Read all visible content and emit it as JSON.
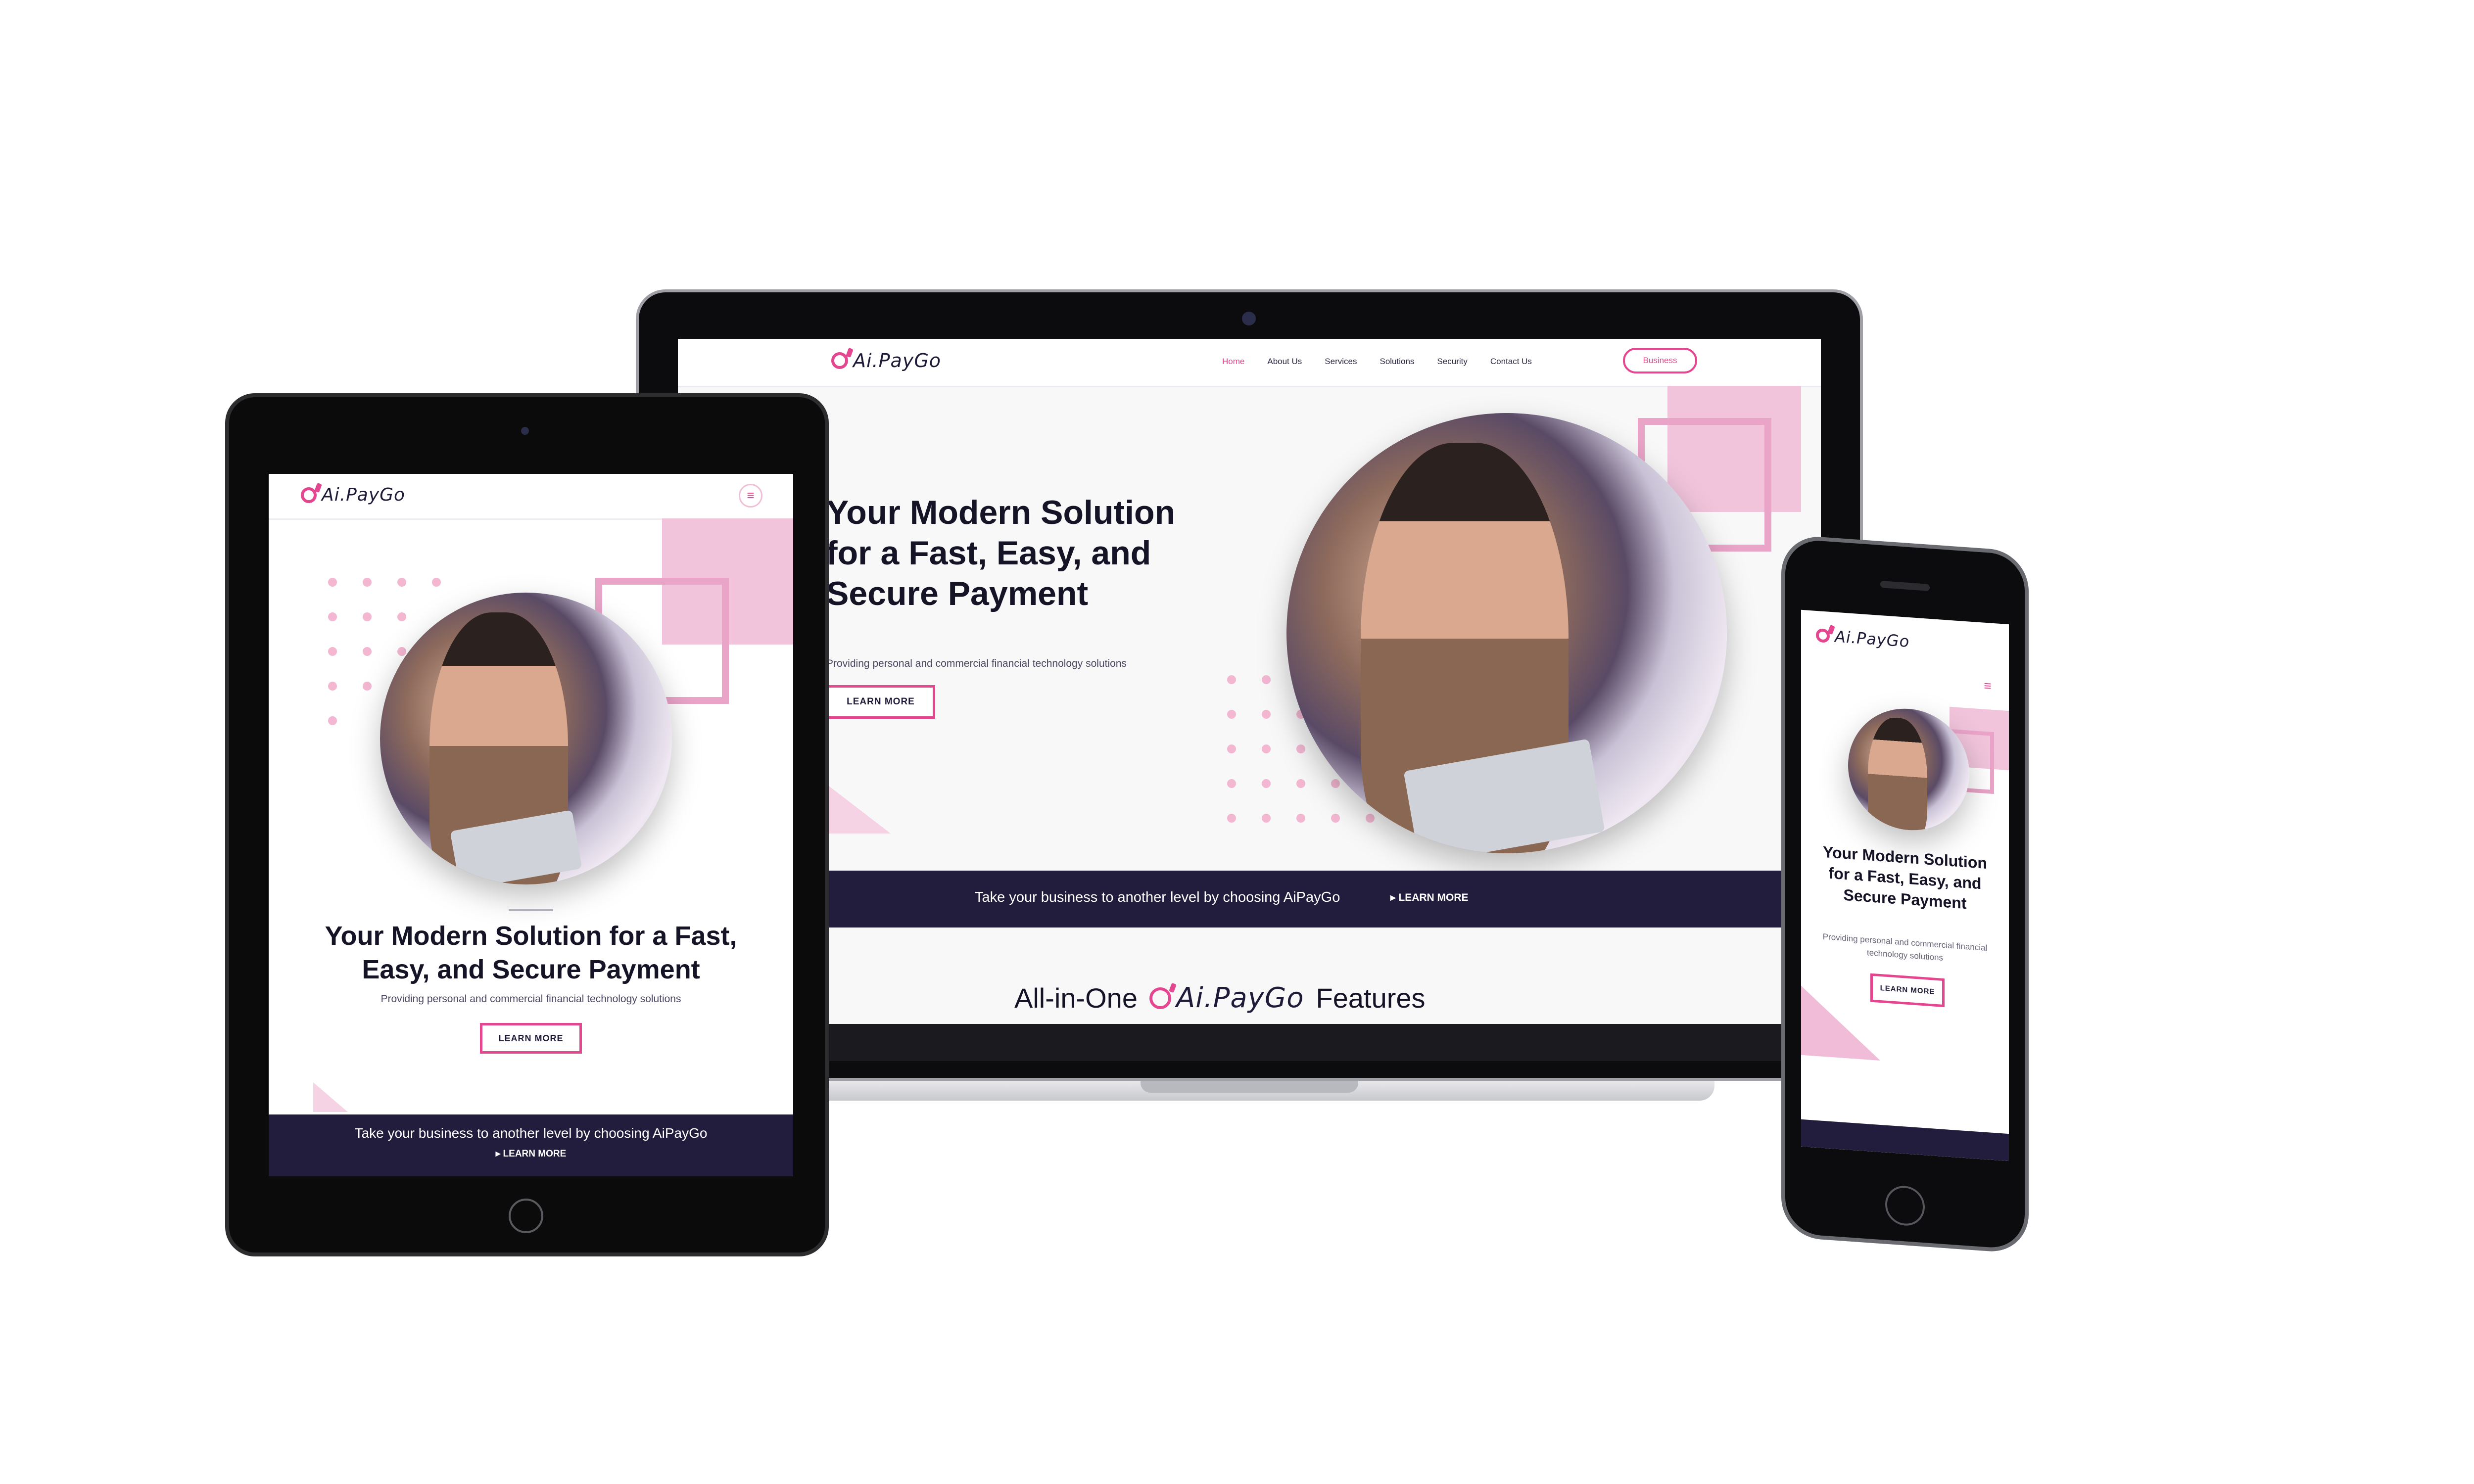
{
  "brand": {
    "name": "Ai.PayGo"
  },
  "laptop": {
    "nav": {
      "items": [
        "Home",
        "About Us",
        "Services",
        "Solutions",
        "Security",
        "Contact Us"
      ],
      "active": "Home",
      "cta": "Business"
    },
    "hero": {
      "title": "Your Modern Solution for a Fast, Easy, and Secure Payment",
      "subtitle": "Providing personal and commercial financial technology solutions",
      "button": "LEARN MORE"
    },
    "band": {
      "text": "Take your business to another level by choosing AiPayGo",
      "link": "LEARN MORE"
    },
    "features": {
      "prefix": "All-in-One",
      "brand": "Ai.PayGo",
      "suffix": "Features"
    }
  },
  "tablet": {
    "menu_icon": "menu-icon",
    "hero": {
      "title": "Your Modern Solution for a Fast, Easy, and Secure Payment",
      "subtitle": "Providing personal and commercial financial technology solutions",
      "button": "LEARN MORE"
    },
    "band": {
      "text": "Take your business to another level by choosing AiPayGo",
      "link": "LEARN MORE"
    }
  },
  "phone": {
    "menu_icon": "menu-icon",
    "hero": {
      "title": "Your Modern Solution for a Fast, Easy, and Secure Payment",
      "subtitle": "Providing personal and commercial financial technology solutions",
      "button": "LEARN MORE"
    }
  },
  "colors": {
    "accent": "#e4468f",
    "dark": "#221d3c",
    "pink_light": "#f1c4dc"
  }
}
